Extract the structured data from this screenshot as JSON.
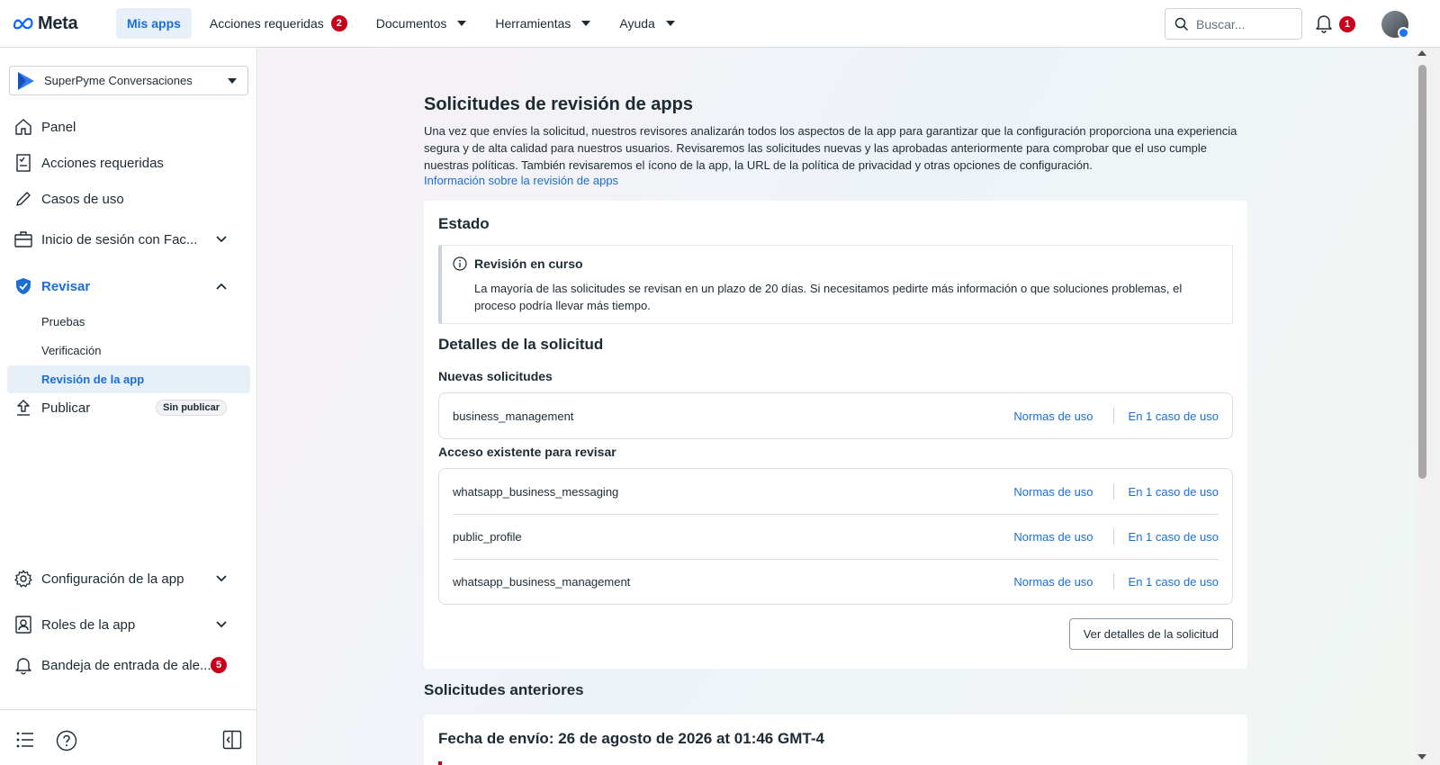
{
  "topbar": {
    "logo_text": "Meta",
    "nav": [
      {
        "label": "Mis apps"
      },
      {
        "label": "Acciones requeridas",
        "badge": "2"
      },
      {
        "label": "Documentos"
      },
      {
        "label": "Herramientas"
      },
      {
        "label": "Ayuda"
      }
    ],
    "search_placeholder": "Buscar...",
    "notifications_badge": "1"
  },
  "sidebar": {
    "app_name": "SuperPyme Conversaciones",
    "items": [
      {
        "label": "Panel",
        "icon": "home-icon"
      },
      {
        "label": "Acciones requeridas",
        "icon": "checklist-icon"
      },
      {
        "label": "Casos de uso",
        "icon": "pencil-icon"
      },
      {
        "label": "Inicio de sesión con Fac...",
        "icon": "briefcase-icon"
      },
      {
        "label": "Revisar",
        "icon": "shield-check-icon"
      },
      {
        "label": "Publicar",
        "icon": "upload-icon",
        "pill": "Sin publicar"
      },
      {
        "label": "Configuración de la app",
        "icon": "gear-icon"
      },
      {
        "label": "Roles de la app",
        "icon": "person-badge-icon"
      },
      {
        "label": "Bandeja de entrada de ale...",
        "icon": "bell-icon",
        "badge": "5"
      }
    ],
    "review_sub": [
      {
        "label": "Pruebas"
      },
      {
        "label": "Verificación"
      },
      {
        "label": "Revisión de la app"
      }
    ]
  },
  "main": {
    "title": "Solicitudes de revisión de apps",
    "description": "Una vez que envíes la solicitud, nuestros revisores analizarán todos los aspectos de la app para garantizar que la configuración proporciona una experiencia segura y de alta calidad para nuestros usuarios. Revisaremos las solicitudes nuevas y las aprobadas anteriormente para comprobar que el uso cumple nuestras políticas. También revisaremos el ícono de la app, la URL de la política de privacidad y otras opciones de configuración.",
    "info_link": "Información sobre la revisión de apps",
    "status": {
      "heading": "Estado",
      "notice_title": "Revisión en curso",
      "notice_body": "La mayoría de las solicitudes se revisan en un plazo de 20 días. Si necesitamos pedirte más información o que soluciones problemas, el proceso podría llevar más tiempo."
    },
    "details_heading": "Detalles de la solicitud",
    "new_requests_heading": "Nuevas solicitudes",
    "new_requests": [
      {
        "name": "business_management",
        "link1": "Normas de uso",
        "link2": "En 1 caso de uso"
      }
    ],
    "existing_heading": "Acceso existente para revisar",
    "existing": [
      {
        "name": "whatsapp_business_messaging",
        "link1": "Normas de uso",
        "link2": "En 1 caso de uso"
      },
      {
        "name": "public_profile",
        "link1": "Normas de uso",
        "link2": "En 1 caso de uso"
      },
      {
        "name": "whatsapp_business_management",
        "link1": "Normas de uso",
        "link2": "En 1 caso de uso"
      }
    ],
    "details_button": "Ver detalles de la solicitud",
    "previous_heading": "Solicitudes anteriores",
    "previous_date": "Fecha de envío: 26 de agosto de 2026 at 01:46 GMT-4"
  },
  "colors": {
    "accent": "#1a6ed8",
    "badge": "#c6001a",
    "active_bg": "#e7f0f9"
  }
}
